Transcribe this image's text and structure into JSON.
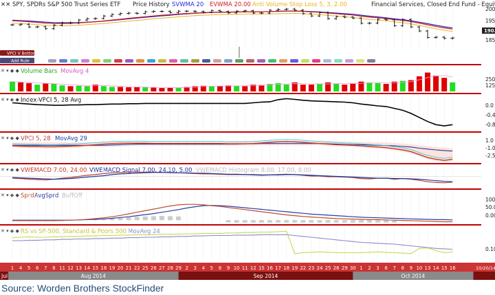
{
  "colors": {
    "divider": "#c00000",
    "volume_up": "#22dd22",
    "volume_down": "#dd0000",
    "date_band_bg": "#cc3333",
    "month_bar_bg": "#7a1010",
    "month_bar_alt": "#8a8a8a",
    "vwma": "#1f2bd0",
    "evwma": "#d11a1a",
    "anti_volume_stop": "#e8b320",
    "vpci_avg": "#1a3a9a",
    "vpci_line": "#c0392b",
    "vpci_fill": "#ffd0c8",
    "vpci_cyan": "#3cc8d8",
    "index_vpci": "#000000",
    "sprd": "#c04a2a",
    "avgsprd": "#2a3da0",
    "rs": "#c8d84a",
    "rs_avg": "#8a8ac8"
  },
  "price_panel": {
    "header": {
      "ticker": "SPY, SPDRs S&P 500 Trust Series ETF",
      "mode": "Price History",
      "vwma": "SVWMA 20",
      "evwma": "EVWMA 20.00",
      "stop": "Anti Volume Stop Loss 5, 3, 2.00",
      "sector": "Financial Services, Closed End Fund - Equity"
    },
    "y_ticks": [
      "200",
      "195",
      "185"
    ],
    "last_price": "190.",
    "tags": [
      "VPCI V Bottom",
      "Add Rule"
    ],
    "ylim": [
      181,
      201
    ]
  },
  "volume_panel": {
    "labels": [
      "Volume Bars",
      "MovAvg 4"
    ],
    "y_ticks": [
      "250",
      "125"
    ],
    "ylim": [
      0,
      300
    ]
  },
  "index_vpci_panel": {
    "labels": [
      "Index-VPCI 5, 28 Avg"
    ],
    "y_ticks": [
      "0.0",
      "-0.4",
      "-0.8"
    ],
    "ylim": [
      -0.95,
      0.15
    ]
  },
  "vpci_panel": {
    "labels": [
      "VPCI 5, 28",
      "MovAvg 29"
    ],
    "y_ticks": [
      "1.0",
      "-1.0",
      "-2.5"
    ],
    "ylim": [
      -3.0,
      1.6
    ]
  },
  "vwemacd_panel": {
    "labels": [
      "VWEMACD 7.00, 24.00",
      "VWEMACD Signal 7.00, 24.10, 5.00",
      "VWEMACD Histogram 8.00, 17.00, 8.00"
    ],
    "y_ticks": [],
    "ylim": [
      -3,
      3
    ]
  },
  "sprd_panel": {
    "labels": [
      "Sprd",
      "AvgSprd",
      "BuffOff"
    ],
    "y_ticks": [
      "100",
      "50.0",
      "0.00"
    ],
    "ylim": [
      -10,
      110
    ]
  },
  "rs_panel": {
    "labels": [
      "RS vs SP-500, Standard & Poors 500",
      "MovAvg 24"
    ],
    "y_ticks": [
      "0.10"
    ],
    "ylim": [
      -0.4,
      0.4
    ]
  },
  "date_axis": {
    "days": [
      "1",
      "4",
      "5",
      "6",
      "7",
      "8",
      "11",
      "12",
      "13",
      "14",
      "15",
      "18",
      "19",
      "20",
      "21",
      "22",
      "25",
      "26",
      "27",
      "28",
      "29",
      "2",
      "3",
      "4",
      "5",
      "8",
      "9",
      "10",
      "11",
      "12",
      "15",
      "16",
      "17",
      "18",
      "19",
      "22",
      "23",
      "24",
      "25",
      "26",
      "29",
      "30",
      "1",
      "2",
      "3",
      "6",
      "7",
      "8",
      "9",
      "10",
      "13",
      "14",
      "15",
      "16"
    ],
    "end_label": "10/20/14",
    "months": [
      {
        "label": "Jul",
        "start": -1,
        "end": 0,
        "alt": false
      },
      {
        "label": "Aug 2014",
        "start": 0,
        "end": 20.5,
        "alt": true
      },
      {
        "label": "Sep 2014",
        "start": 20.5,
        "end": 41.5,
        "alt": false
      },
      {
        "label": "Oct 2014",
        "start": 41.5,
        "end": 56,
        "alt": true
      }
    ]
  },
  "chart_data": {
    "type": "line",
    "x": [
      "Aug 1",
      "Aug 4",
      "Aug 5",
      "Aug 6",
      "Aug 7",
      "Aug 8",
      "Aug 11",
      "Aug 12",
      "Aug 13",
      "Aug 14",
      "Aug 15",
      "Aug 18",
      "Aug 19",
      "Aug 20",
      "Aug 21",
      "Aug 22",
      "Aug 25",
      "Aug 26",
      "Aug 27",
      "Aug 28",
      "Aug 29",
      "Sep 2",
      "Sep 3",
      "Sep 4",
      "Sep 5",
      "Sep 8",
      "Sep 9",
      "Sep 10",
      "Sep 11",
      "Sep 12",
      "Sep 15",
      "Sep 16",
      "Sep 17",
      "Sep 18",
      "Sep 19",
      "Sep 22",
      "Sep 23",
      "Sep 24",
      "Sep 25",
      "Sep 26",
      "Sep 29",
      "Sep 30",
      "Oct 1",
      "Oct 2",
      "Oct 3",
      "Oct 6",
      "Oct 7",
      "Oct 8",
      "Oct 9",
      "Oct 10",
      "Oct 13",
      "Oct 14",
      "Oct 15",
      "Oct 16"
    ],
    "series": [
      {
        "name": "SPY",
        "values": [
          193.1,
          193.4,
          192.0,
          192.1,
          191.1,
          192.9,
          194.2,
          194.0,
          195.6,
          196.3,
          196.4,
          197.7,
          198.5,
          199.0,
          199.2,
          199.0,
          199.9,
          200.1,
          200.1,
          199.5,
          200.2,
          200.2,
          200.0,
          199.7,
          200.5,
          200.0,
          199.3,
          200.2,
          200.4,
          199.2,
          199.2,
          200.7,
          201.1,
          201.3,
          200.7,
          198.9,
          197.7,
          199.5,
          196.3,
          197.4,
          197.1,
          196.6,
          193.9,
          194.0,
          196.0,
          195.7,
          192.6,
          195.9,
          192.0,
          189.9,
          186.5,
          186.7,
          186.1,
          186.3
        ]
      },
      {
        "name": "SVWMA 20",
        "values": [
          195.5,
          195.3,
          195.1,
          194.8,
          194.5,
          194.3,
          194.2,
          194.2,
          194.3,
          194.5,
          194.7,
          195.0,
          195.4,
          195.8,
          196.2,
          196.6,
          197.0,
          197.4,
          197.8,
          198.1,
          198.5,
          198.8,
          199.1,
          199.3,
          199.5,
          199.6,
          199.7,
          199.8,
          199.9,
          199.9,
          199.9,
          200.0,
          200.1,
          200.2,
          200.3,
          200.2,
          200.0,
          199.8,
          199.5,
          199.2,
          198.9,
          198.6,
          198.1,
          197.6,
          197.2,
          196.8,
          196.2,
          195.8,
          195.2,
          194.5,
          193.7,
          192.9,
          192.1,
          191.5
        ]
      },
      {
        "name": "EVWMA 20.00",
        "values": [
          195.2,
          195.0,
          194.7,
          194.4,
          194.0,
          193.8,
          193.8,
          193.9,
          194.1,
          194.4,
          194.7,
          195.1,
          195.6,
          196.0,
          196.5,
          196.9,
          197.3,
          197.7,
          198.1,
          198.4,
          198.7,
          199.0,
          199.2,
          199.4,
          199.6,
          199.7,
          199.7,
          199.8,
          199.9,
          199.9,
          199.9,
          200.0,
          200.2,
          200.3,
          200.3,
          200.1,
          199.8,
          199.6,
          199.2,
          198.9,
          198.5,
          198.2,
          197.6,
          197.1,
          196.8,
          196.4,
          195.8,
          195.4,
          194.8,
          194.0,
          193.1,
          192.3,
          191.5,
          190.9
        ]
      }
    ],
    "volume": [
      {
        "up": true,
        "v": 130
      },
      {
        "up": false,
        "v": 120
      },
      {
        "up": false,
        "v": 110
      },
      {
        "up": true,
        "v": 90
      },
      {
        "up": false,
        "v": 110
      },
      {
        "up": true,
        "v": 100
      },
      {
        "up": true,
        "v": 80
      },
      {
        "up": false,
        "v": 70
      },
      {
        "up": true,
        "v": 75
      },
      {
        "up": true,
        "v": 70
      },
      {
        "up": false,
        "v": 90
      },
      {
        "up": true,
        "v": 70
      },
      {
        "up": true,
        "v": 60
      },
      {
        "up": false,
        "v": 60
      },
      {
        "up": false,
        "v": 55
      },
      {
        "up": false,
        "v": 60
      },
      {
        "up": true,
        "v": 55
      },
      {
        "up": false,
        "v": 50
      },
      {
        "up": false,
        "v": 45
      },
      {
        "up": false,
        "v": 50
      },
      {
        "up": true,
        "v": 55
      },
      {
        "up": false,
        "v": 60
      },
      {
        "up": false,
        "v": 70
      },
      {
        "up": false,
        "v": 75
      },
      {
        "up": true,
        "v": 70
      },
      {
        "up": false,
        "v": 70
      },
      {
        "up": false,
        "v": 80
      },
      {
        "up": true,
        "v": 75
      },
      {
        "up": false,
        "v": 70
      },
      {
        "up": false,
        "v": 90
      },
      {
        "up": false,
        "v": 85
      },
      {
        "up": true,
        "v": 100
      },
      {
        "up": true,
        "v": 110
      },
      {
        "up": true,
        "v": 90
      },
      {
        "up": false,
        "v": 120
      },
      {
        "up": false,
        "v": 90
      },
      {
        "up": false,
        "v": 90
      },
      {
        "up": true,
        "v": 100
      },
      {
        "up": false,
        "v": 120
      },
      {
        "up": true,
        "v": 100
      },
      {
        "up": false,
        "v": 90
      },
      {
        "up": false,
        "v": 110
      },
      {
        "up": false,
        "v": 130
      },
      {
        "up": true,
        "v": 120
      },
      {
        "up": true,
        "v": 110
      },
      {
        "up": false,
        "v": 100
      },
      {
        "up": false,
        "v": 130
      },
      {
        "up": true,
        "v": 140
      },
      {
        "up": false,
        "v": 150
      },
      {
        "up": false,
        "v": 200
      },
      {
        "up": false,
        "v": 250
      },
      {
        "up": false,
        "v": 210
      },
      {
        "up": false,
        "v": 180
      },
      {
        "up": true,
        "v": 120
      }
    ],
    "index_vpci": [
      -0.08,
      -0.1,
      -0.12,
      -0.14,
      -0.15,
      -0.16,
      -0.16,
      -0.15,
      -0.15,
      -0.14,
      -0.14,
      -0.13,
      -0.12,
      -0.12,
      -0.11,
      -0.11,
      -0.1,
      -0.1,
      -0.1,
      -0.1,
      -0.1,
      -0.1,
      -0.1,
      -0.1,
      -0.1,
      -0.1,
      -0.1,
      -0.1,
      -0.1,
      -0.08,
      -0.06,
      -0.05,
      0.02,
      0.05,
      0.03,
      0.0,
      -0.02,
      -0.03,
      -0.04,
      -0.05,
      -0.06,
      -0.08,
      -0.12,
      -0.15,
      -0.18,
      -0.2,
      -0.26,
      -0.32,
      -0.42,
      -0.55,
      -0.68,
      -0.78,
      -0.82,
      -0.78
    ],
    "vpci": [
      -0.3,
      -0.35,
      -0.4,
      -0.4,
      -0.45,
      -0.45,
      -0.4,
      -0.35,
      -0.3,
      -0.2,
      -0.1,
      0.0,
      0.1,
      0.15,
      0.15,
      0.15,
      0.15,
      0.1,
      0.1,
      0.1,
      0.1,
      0.1,
      0.1,
      0.1,
      0.1,
      0.1,
      0.05,
      0.05,
      0.05,
      0.1,
      0.2,
      0.3,
      0.4,
      0.45,
      0.4,
      0.3,
      0.2,
      0.1,
      0.0,
      -0.1,
      -0.15,
      -0.2,
      -0.3,
      -0.4,
      -0.5,
      -0.6,
      -0.8,
      -1.0,
      -1.3,
      -1.8,
      -2.3,
      -2.6,
      -2.8,
      -2.6
    ],
    "vpci_avg": [
      -0.2,
      -0.2,
      -0.2,
      -0.2,
      -0.2,
      -0.2,
      -0.2,
      -0.2,
      -0.2,
      -0.2,
      -0.2,
      -0.2,
      -0.15,
      -0.1,
      -0.05,
      0.0,
      0.0,
      0.0,
      0.0,
      0.0,
      0.0,
      0.0,
      0.0,
      0.0,
      0.0,
      0.0,
      0.0,
      0.0,
      0.05,
      0.05,
      0.1,
      0.1,
      0.1,
      0.1,
      0.1,
      0.1,
      0.1,
      0.1,
      0.05,
      0.0,
      -0.05,
      -0.1,
      -0.1,
      -0.15,
      -0.2,
      -0.25,
      -0.3,
      -0.4,
      -0.5,
      -0.7,
      -0.85,
      -1.0,
      -1.1,
      -1.2
    ],
    "vwemacd": [
      -0.5,
      -0.6,
      -0.8,
      -0.9,
      -1.0,
      -0.8,
      -0.5,
      -0.3,
      0.0,
      0.3,
      0.5,
      0.8,
      1.0,
      1.1,
      1.2,
      1.2,
      1.2,
      1.2,
      1.1,
      1.0,
      1.0,
      0.9,
      0.8,
      0.7,
      0.7,
      0.6,
      0.5,
      0.5,
      0.5,
      0.4,
      0.3,
      0.4,
      0.5,
      0.6,
      0.5,
      0.3,
      0.1,
      0.1,
      -0.1,
      -0.1,
      -0.2,
      -0.3,
      -0.6,
      -0.7,
      -0.5,
      -0.5,
      -0.8,
      -0.6,
      -0.8,
      -1.1,
      -1.5,
      -1.7,
      -1.8,
      -1.6
    ],
    "vwemacd_signal": [
      -0.3,
      -0.4,
      -0.5,
      -0.6,
      -0.7,
      -0.8,
      -0.7,
      -0.6,
      -0.4,
      -0.2,
      0.0,
      0.2,
      0.5,
      0.7,
      0.8,
      0.9,
      1.0,
      1.1,
      1.1,
      1.1,
      1.0,
      1.0,
      0.9,
      0.9,
      0.8,
      0.7,
      0.6,
      0.6,
      0.5,
      0.5,
      0.4,
      0.4,
      0.4,
      0.5,
      0.5,
      0.4,
      0.3,
      0.2,
      0.1,
      0.0,
      -0.1,
      -0.2,
      -0.3,
      -0.4,
      -0.5,
      -0.5,
      -0.6,
      -0.6,
      -0.7,
      -0.8,
      -1.0,
      -1.2,
      -1.4,
      -1.5
    ],
    "sprd": [
      -2,
      -2,
      -2,
      -2,
      -2,
      -2,
      -1,
      0,
      1,
      3,
      6,
      9,
      13,
      18,
      24,
      30,
      36,
      42,
      48,
      54,
      58,
      60,
      60,
      58,
      55,
      52,
      48,
      44,
      40,
      36,
      32,
      28,
      24,
      20,
      17,
      14,
      12,
      10,
      8,
      6,
      5,
      4,
      3,
      2,
      2,
      1,
      0,
      -1,
      -2,
      -3,
      -4,
      -5,
      -6,
      -6
    ],
    "avgsprd": [
      0,
      0,
      0,
      0,
      0,
      0,
      0,
      0,
      1,
      2,
      3,
      5,
      7,
      10,
      13,
      17,
      21,
      25,
      30,
      35,
      40,
      46,
      51,
      55,
      56,
      55,
      53,
      50,
      47,
      44,
      41,
      38,
      35,
      32,
      29,
      26,
      23,
      21,
      19,
      17,
      15,
      13,
      11,
      10,
      9,
      8,
      7,
      6,
      5,
      4,
      3,
      2,
      2,
      1
    ],
    "buffoff": [
      0,
      0,
      0,
      0,
      0,
      0,
      0,
      0,
      0,
      0,
      3,
      5,
      7,
      9,
      11,
      13,
      14,
      15,
      16,
      15,
      14,
      0,
      0,
      0,
      0,
      0,
      -8,
      -9,
      -9,
      -9,
      -9,
      -9,
      -9,
      -9,
      -9,
      -9,
      -9,
      -9,
      -9,
      -9,
      -9,
      -9,
      -9,
      -9,
      -9,
      -9,
      -9,
      0,
      0,
      0,
      0,
      0,
      0,
      0
    ],
    "rs": [
      0.15,
      0.16,
      0.17,
      0.16,
      0.16,
      0.17,
      0.17,
      0.18,
      0.18,
      0.19,
      0.19,
      0.2,
      0.2,
      0.21,
      0.21,
      0.22,
      0.22,
      0.22,
      0.23,
      0.23,
      0.23,
      0.24,
      0.24,
      0.25,
      0.25,
      0.25,
      0.26,
      0.26,
      0.27,
      0.27,
      0.28,
      0.28,
      0.29,
      0.3,
      -0.22,
      -0.2,
      -0.19,
      -0.18,
      -0.19,
      -0.2,
      -0.2,
      -0.2,
      -0.2,
      -0.19,
      -0.18,
      -0.19,
      -0.2,
      -0.21,
      -0.22,
      -0.1,
      -0.09,
      -0.15,
      -0.2,
      -0.18
    ],
    "rs_avg": [
      0.08,
      0.08,
      0.09,
      0.09,
      0.1,
      0.1,
      0.11,
      0.11,
      0.12,
      0.12,
      0.13,
      0.13,
      0.14,
      0.14,
      0.15,
      0.15,
      0.16,
      0.16,
      0.17,
      0.17,
      0.18,
      0.18,
      0.19,
      0.19,
      0.2,
      0.2,
      0.2,
      0.21,
      0.21,
      0.21,
      0.22,
      0.22,
      0.22,
      0.22,
      0.2,
      0.18,
      0.16,
      0.14,
      0.12,
      0.1,
      0.08,
      0.06,
      0.04,
      0.03,
      0.02,
      0.01,
      0.0,
      -0.02,
      -0.04,
      -0.06,
      -0.08,
      -0.1,
      -0.11,
      -0.12
    ]
  },
  "source": "Source: Worden Brothers StockFinder"
}
